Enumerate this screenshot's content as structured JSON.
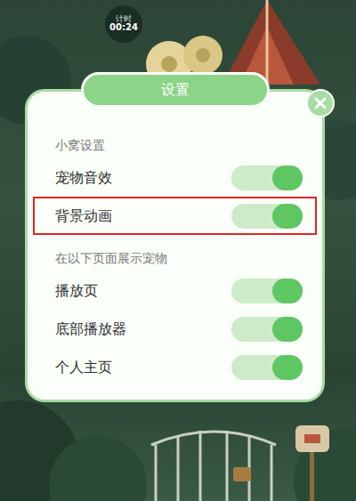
{
  "timer": {
    "label": "计时",
    "time": "00:24"
  },
  "dialog": {
    "title": "设置",
    "sections": [
      {
        "title": "小窝设置",
        "items": [
          {
            "label": "宠物音效",
            "on": true,
            "highlighted": false
          },
          {
            "label": "背景动画",
            "on": true,
            "highlighted": true
          }
        ]
      },
      {
        "title": "在以下页面展示宠物",
        "items": [
          {
            "label": "播放页",
            "on": true,
            "highlighted": false
          },
          {
            "label": "底部播放器",
            "on": true,
            "highlighted": false
          },
          {
            "label": "个人主页",
            "on": true,
            "highlighted": false
          }
        ]
      }
    ]
  }
}
